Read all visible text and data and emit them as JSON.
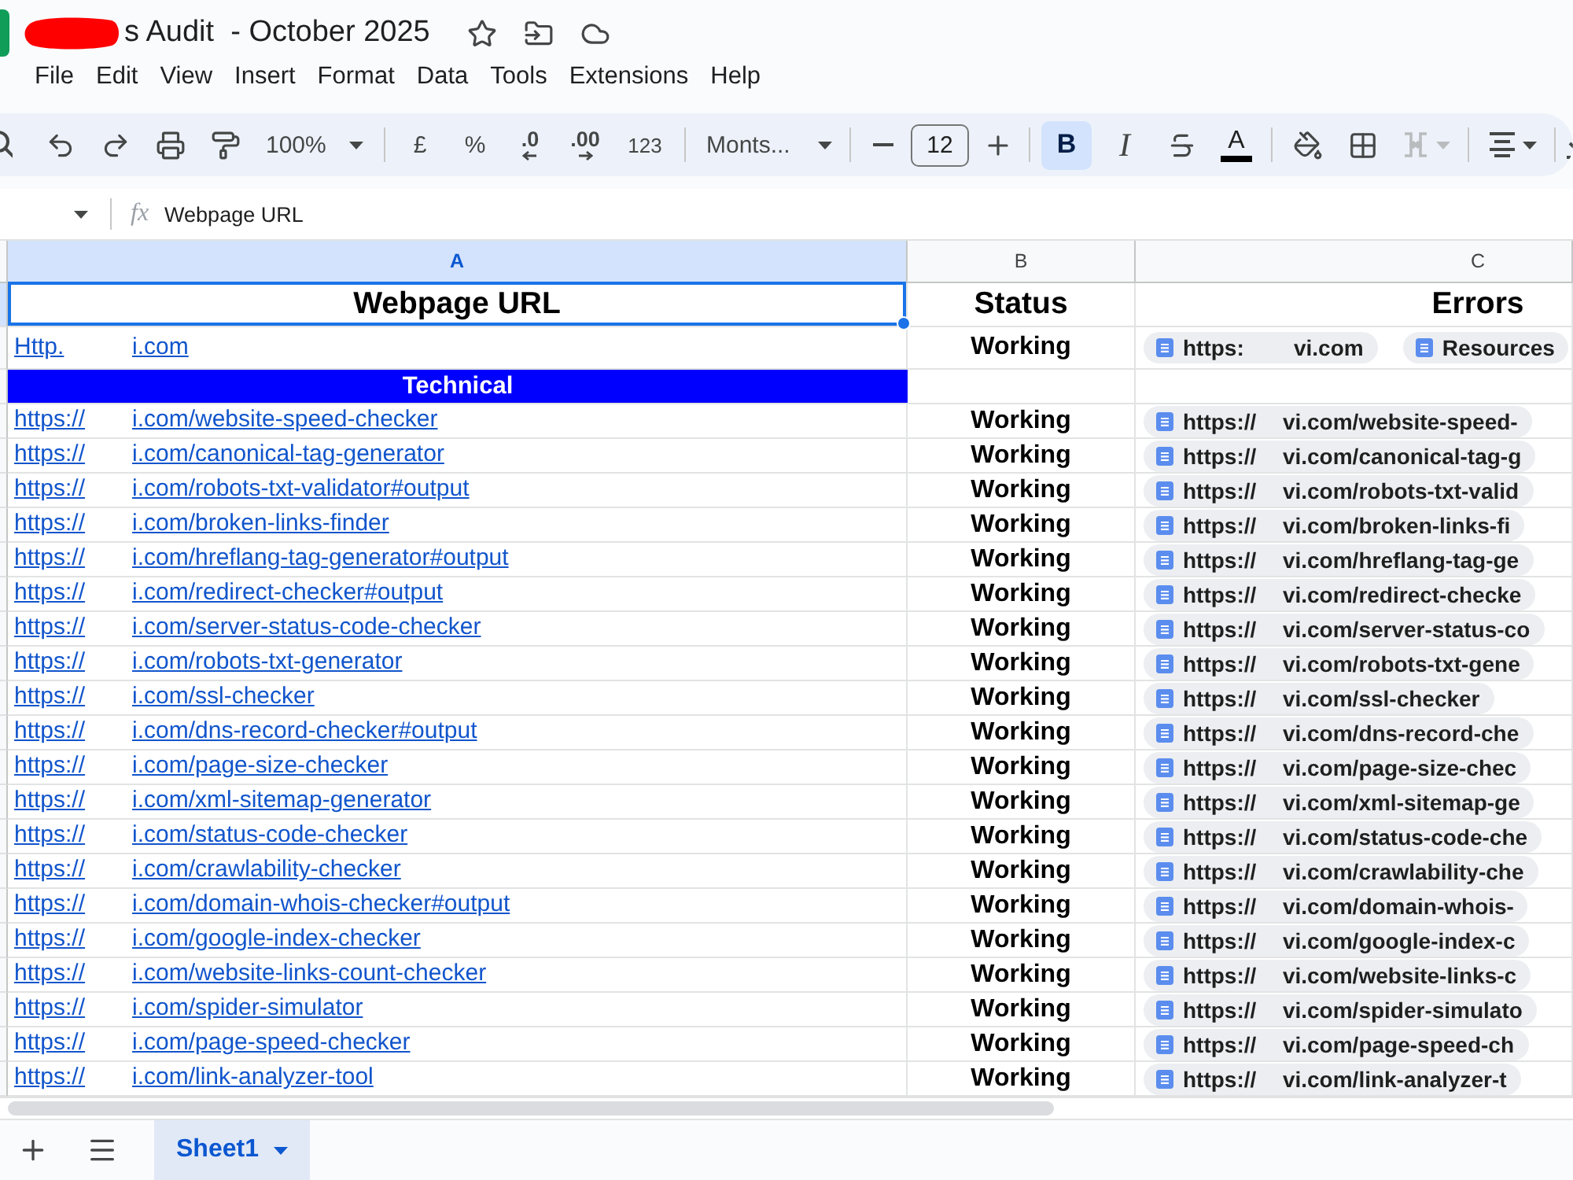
{
  "document": {
    "title": "s Audit  - October 2025"
  },
  "menu": [
    "File",
    "Edit",
    "View",
    "Insert",
    "Format",
    "Data",
    "Tools",
    "Extensions",
    "Help"
  ],
  "toolbar": {
    "zoom": "100%",
    "currency": "£",
    "percent": "%",
    "decrease_decimal": ".0",
    "increase_decimal": ".00",
    "number_format": "123",
    "font": "Monts...",
    "font_size": "12",
    "styles": [
      {
        "label": "B",
        "selected": true
      },
      {
        "label": "I",
        "selected": false
      }
    ],
    "text_color": "A",
    "merge": {
      "disabled": true
    }
  },
  "formula_bar": {
    "fx": "fx",
    "value": "Webpage URL"
  },
  "sheet": {
    "columns": [
      {
        "label": "A",
        "selected": true
      },
      {
        "label": "B",
        "selected": false
      },
      {
        "label": "C",
        "selected": false
      }
    ],
    "header": [
      {
        "label": "Webpage URL",
        "selected": true
      },
      {
        "label": "Status",
        "selected": false
      },
      {
        "label": "Errors",
        "selected": false
      }
    ],
    "rows": [
      {
        "kind": "link",
        "url": [
          "Http.",
          "i.com"
        ],
        "status": "Working",
        "chips": [
          [
            "https:",
            "vi.com"
          ],
          [
            "Resources"
          ]
        ]
      },
      {
        "kind": "section",
        "label": "Technical"
      },
      {
        "kind": "link",
        "url": [
          "https://",
          "i.com/website-speed-checker"
        ],
        "status": "Working",
        "chips": [
          [
            "https://",
            "vi.com/website-speed-"
          ]
        ]
      },
      {
        "kind": "link",
        "url": [
          "https://",
          "i.com/canonical-tag-generator"
        ],
        "status": "Working",
        "chips": [
          [
            "https://",
            "vi.com/canonical-tag-g"
          ]
        ]
      },
      {
        "kind": "link",
        "url": [
          "https://",
          "i.com/robots-txt-validator#output"
        ],
        "status": "Working",
        "chips": [
          [
            "https://",
            "vi.com/robots-txt-valid"
          ]
        ]
      },
      {
        "kind": "link",
        "url": [
          "https://",
          "i.com/broken-links-finder"
        ],
        "status": "Working",
        "chips": [
          [
            "https://",
            "vi.com/broken-links-fi"
          ]
        ]
      },
      {
        "kind": "link",
        "url": [
          "https://",
          "i.com/hreflang-tag-generator#output"
        ],
        "status": "Working",
        "chips": [
          [
            "https://",
            "vi.com/hreflang-tag-ge"
          ]
        ]
      },
      {
        "kind": "link",
        "url": [
          "https://",
          "i.com/redirect-checker#output"
        ],
        "status": "Working",
        "chips": [
          [
            "https://",
            "vi.com/redirect-checke"
          ]
        ]
      },
      {
        "kind": "link",
        "url": [
          "https://",
          "i.com/server-status-code-checker"
        ],
        "status": "Working",
        "chips": [
          [
            "https://",
            "vi.com/server-status-co"
          ]
        ]
      },
      {
        "kind": "link",
        "url": [
          "https://",
          "i.com/robots-txt-generator"
        ],
        "status": "Working",
        "chips": [
          [
            "https://",
            "vi.com/robots-txt-gene"
          ]
        ]
      },
      {
        "kind": "link",
        "url": [
          "https://",
          "i.com/ssl-checker"
        ],
        "status": "Working",
        "chips": [
          [
            "https://",
            "vi.com/ssl-checker"
          ]
        ]
      },
      {
        "kind": "link",
        "url": [
          "https://",
          "i.com/dns-record-checker#output"
        ],
        "status": "Working",
        "chips": [
          [
            "https://",
            "vi.com/dns-record-che"
          ]
        ]
      },
      {
        "kind": "link",
        "url": [
          "https://",
          "i.com/page-size-checker"
        ],
        "status": "Working",
        "chips": [
          [
            "https://",
            "vi.com/page-size-chec"
          ]
        ]
      },
      {
        "kind": "link",
        "url": [
          "https://",
          "i.com/xml-sitemap-generator"
        ],
        "status": "Working",
        "chips": [
          [
            "https://",
            "vi.com/xml-sitemap-ge"
          ]
        ]
      },
      {
        "kind": "link",
        "url": [
          "https://",
          "i.com/status-code-checker"
        ],
        "status": "Working",
        "chips": [
          [
            "https://",
            "vi.com/status-code-che"
          ]
        ]
      },
      {
        "kind": "link",
        "url": [
          "https://",
          "i.com/crawlability-checker"
        ],
        "status": "Working",
        "chips": [
          [
            "https://",
            "vi.com/crawlability-che"
          ]
        ]
      },
      {
        "kind": "link",
        "url": [
          "https://",
          "i.com/domain-whois-checker#output"
        ],
        "status": "Working",
        "chips": [
          [
            "https://",
            "vi.com/domain-whois-"
          ]
        ]
      },
      {
        "kind": "link",
        "url": [
          "https://",
          "i.com/google-index-checker"
        ],
        "status": "Working",
        "chips": [
          [
            "https://",
            "vi.com/google-index-c"
          ]
        ]
      },
      {
        "kind": "link",
        "url": [
          "https://",
          "i.com/website-links-count-checker"
        ],
        "status": "Working",
        "chips": [
          [
            "https://",
            "vi.com/website-links-c"
          ]
        ]
      },
      {
        "kind": "link",
        "url": [
          "https://",
          "i.com/spider-simulator"
        ],
        "status": "Working",
        "chips": [
          [
            "https://",
            "vi.com/spider-simulato"
          ]
        ]
      },
      {
        "kind": "link",
        "url": [
          "https://",
          "i.com/page-speed-checker"
        ],
        "status": "Working",
        "chips": [
          [
            "https://",
            "vi.com/page-speed-ch"
          ]
        ]
      },
      {
        "kind": "link",
        "url": [
          "https://",
          "i.com/link-analyzer-tool"
        ],
        "status": "Working",
        "chips": [
          [
            "https://",
            "vi.com/link-analyzer-t"
          ]
        ]
      }
    ]
  },
  "sheet_tabs": [
    {
      "label": "Sheet1",
      "selected": true
    }
  ]
}
